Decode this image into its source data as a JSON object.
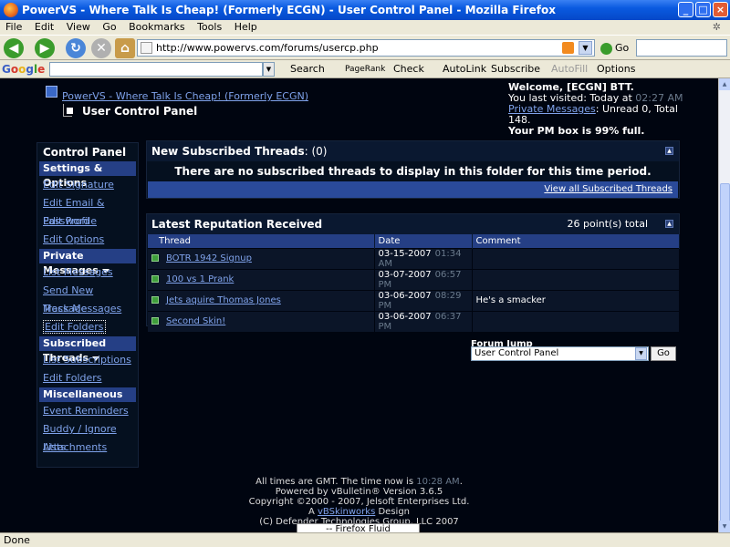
{
  "window": {
    "title": "PowerVS - Where Talk Is Cheap! (Formerly ECGN) - User Control Panel - Mozilla Firefox"
  },
  "menu": [
    "File",
    "Edit",
    "View",
    "Go",
    "Bookmarks",
    "Tools",
    "Help"
  ],
  "nav": {
    "url": "http://www.powervs.com/forums/usercp.php",
    "go_label": "Go"
  },
  "google_bar": {
    "logo": "Google",
    "search_label": "Search",
    "pagerank": "PageRank",
    "check_label": "Check",
    "autolink": "AutoLink",
    "subscribe": "Subscribe",
    "autofill": "AutoFill",
    "options": "Options"
  },
  "breadcrumb": {
    "root": "PowerVS - Where Talk Is Cheap! (Formerly ECGN)",
    "current": "User Control Panel"
  },
  "welcome": {
    "greeting": "Welcome, [ECGN] BTT.",
    "last_visited_label": "You last visited: Today at",
    "last_visited_time": "02:27 AM",
    "pm_link": "Private Messages",
    "pm_status": ": Unread 0, Total 148.",
    "pm_box": "Your PM box is 99% full."
  },
  "sidebar": {
    "title": "Control Panel",
    "sections": [
      {
        "label": "Settings & Options",
        "items": [
          "Edit Signature",
          "Edit Email & Password",
          "Edit Profile",
          "Edit Options"
        ]
      },
      {
        "label": "Private Messages",
        "items": [
          "List Messages",
          "Send New Message",
          "Track Messages",
          "Edit Folders"
        ]
      },
      {
        "label": "Subscribed Threads",
        "items": [
          "List Subscriptions",
          "Edit Folders"
        ]
      },
      {
        "label": "Miscellaneous",
        "items": [
          "Event Reminders",
          "Buddy / Ignore Lists",
          "Attachments"
        ]
      }
    ]
  },
  "subscribed": {
    "title": "New Subscribed Threads",
    "count": ": (0)",
    "message": "There are no subscribed threads to display in this folder for this time period.",
    "view_all": "View all Subscribed Threads"
  },
  "reputation": {
    "title": "Latest Reputation Received",
    "total": "26 point(s) total",
    "columns": [
      "Thread",
      "Date",
      "Comment"
    ],
    "rows": [
      {
        "thread": "BOTR 1942 Signup",
        "date": "03-15-2007",
        "time": "01:34 AM",
        "comment": ""
      },
      {
        "thread": "100 vs 1 Prank",
        "date": "03-07-2007",
        "time": "06:57 PM",
        "comment": ""
      },
      {
        "thread": "Jets aquire Thomas Jones",
        "date": "03-06-2007",
        "time": "08:29 PM",
        "comment": "He's a smacker"
      },
      {
        "thread": "Second Skin!",
        "date": "03-06-2007",
        "time": "06:37 PM",
        "comment": ""
      }
    ]
  },
  "forum_jump": {
    "label": "Forum Jump",
    "selected": "User Control Panel",
    "go": "Go"
  },
  "footer": {
    "line1_pre": "All times are GMT. The time now is",
    "time": "10:28 AM",
    "line1_post": ".",
    "line2": "Powered by vBulletin® Version 3.6.5",
    "line3": "Copyright ©2000 - 2007, Jelsoft Enterprises Ltd.",
    "line4_pre": "A",
    "line4_link": "vBSkinworks",
    "line4_post": "Design",
    "line5": "(C) Defender Technologies Group, LLC 2007",
    "style": "-- Firefox Fluid"
  },
  "status": "Done"
}
